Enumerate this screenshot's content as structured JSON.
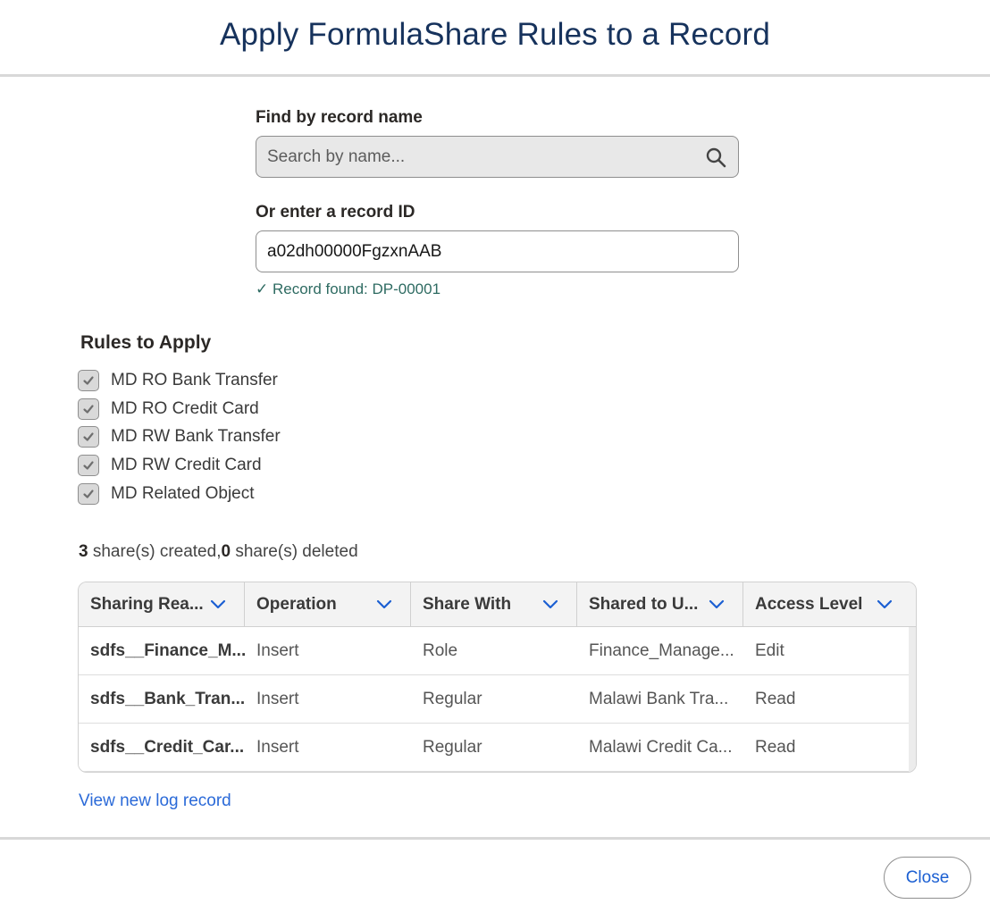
{
  "header": {
    "title": "Apply FormulaShare Rules to a Record"
  },
  "search": {
    "label": "Find by record name",
    "placeholder": "Search by name...",
    "icon": "search-icon"
  },
  "record_id": {
    "label": "Or enter a record ID",
    "value": "a02dh00000FgzxnAAB",
    "status": "✓ Record found: DP-00001"
  },
  "rules": {
    "title": "Rules to Apply",
    "items": [
      {
        "label": "MD RO Bank Transfer",
        "checked": true
      },
      {
        "label": "MD RO Credit Card",
        "checked": true
      },
      {
        "label": "MD RW Bank Transfer",
        "checked": true
      },
      {
        "label": "MD RW Credit Card",
        "checked": true
      },
      {
        "label": "MD Related Object",
        "checked": true
      }
    ]
  },
  "summary": {
    "created_count": "3",
    "created_text": " share(s) created,",
    "deleted_count": "0",
    "deleted_text": " share(s) deleted"
  },
  "table": {
    "columns": [
      "Sharing Rea...",
      "Operation",
      "Share With",
      "Shared to U...",
      "Access Level"
    ],
    "rows": [
      [
        "sdfs__Finance_M...",
        "Insert",
        "Role",
        "Finance_Manage...",
        "Edit"
      ],
      [
        "sdfs__Bank_Tran...",
        "Insert",
        "Regular",
        "Malawi Bank Tra...",
        "Read"
      ],
      [
        "sdfs__Credit_Car...",
        "Insert",
        "Regular",
        "Malawi Credit Ca...",
        "Read"
      ]
    ]
  },
  "log_link": "View new log record",
  "footer": {
    "close_label": "Close"
  },
  "colors": {
    "title": "#16325c",
    "link": "#2b6ad8",
    "success": "#2e6b62",
    "chevron": "#1b5fd2"
  }
}
